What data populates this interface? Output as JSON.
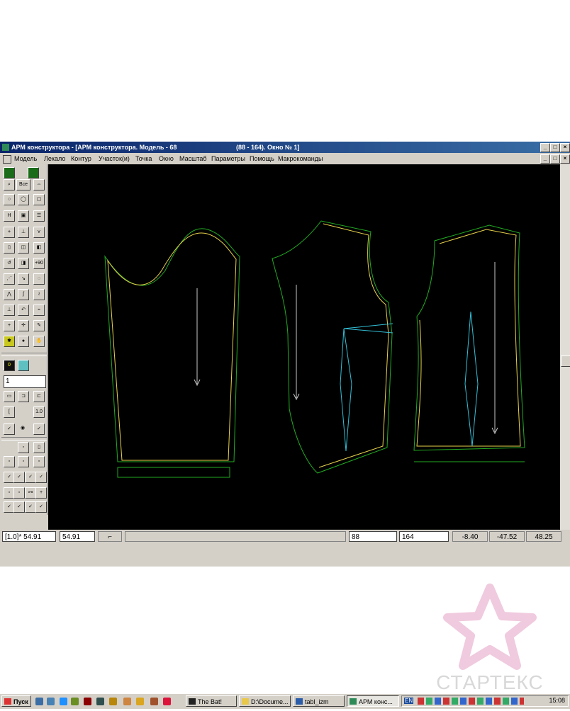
{
  "window": {
    "title": "АРМ конструктора - [АРМ конструктора. Модель - 68",
    "title_right": "(88 - 164). Окно № 1]"
  },
  "menu": [
    "Модель",
    "Лекало",
    "Контур",
    "Участок(и)",
    "Точка",
    "Окно",
    "Масштаб",
    "Параметры",
    "Помощь",
    "Макрокоманды"
  ],
  "toolbox": {
    "all_label": "Все",
    "rotate_label": "+90",
    "ratio_label": "1.0",
    "value_input": "1"
  },
  "status": {
    "scale_label": "[1.0]* 54.91",
    "scale_value": "54.91",
    "size1": "88",
    "size2": "164",
    "coord_x": "-8.40",
    "coord_y": "-47.52",
    "coord_z": "48.25"
  },
  "taskbar": {
    "start": "Пуск",
    "tasks": [
      "The Bat!",
      "D:\\Docume...",
      "tabl_izm",
      "АРМ конс..."
    ],
    "lang": "EN",
    "clock": "15:08"
  },
  "watermark": "СТАРТЕКС",
  "colors": {
    "canvas": "#000000",
    "outline_green": "#22aa22",
    "outline_yellow": "#e8d24a",
    "dart_cyan": "#33c0d8",
    "axis_grey": "#c8c8c8"
  }
}
